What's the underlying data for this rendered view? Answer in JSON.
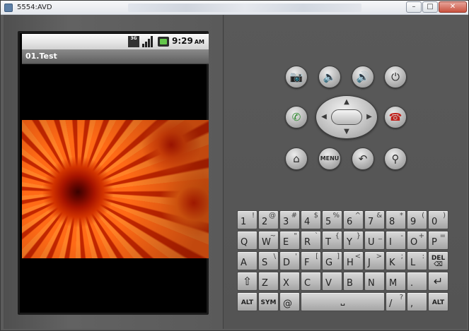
{
  "window": {
    "title": "5554:AVD",
    "minimize_icon": "minimize-icon",
    "maximize_icon": "maximize-icon",
    "close_icon": "close-icon"
  },
  "device": {
    "status_bar": {
      "network": "3G",
      "time": "9:29",
      "ampm": "AM",
      "icons": [
        "3g-icon",
        "signal-bars-icon",
        "battery-icon"
      ]
    },
    "app_title": "01.Test",
    "image": "flower-image"
  },
  "controls": {
    "camera_icon": "camera-icon",
    "volume_down_icon": "volume-down-icon",
    "volume_up_icon": "volume-up-icon",
    "power_icon": "power-icon",
    "call_icon": "call-icon",
    "end_call_icon": "end-call-icon",
    "home_icon": "home-icon",
    "menu_label": "MENU",
    "back_icon": "back-icon",
    "search_icon": "search-icon"
  },
  "keyboard": {
    "rows": [
      [
        {
          "m": "1",
          "a": "!"
        },
        {
          "m": "2",
          "a": "@"
        },
        {
          "m": "3",
          "a": "#"
        },
        {
          "m": "4",
          "a": "$"
        },
        {
          "m": "5",
          "a": "%"
        },
        {
          "m": "6",
          "a": "^"
        },
        {
          "m": "7",
          "a": "&"
        },
        {
          "m": "8",
          "a": "*"
        },
        {
          "m": "9",
          "a": "("
        },
        {
          "m": "0",
          "a": ")"
        }
      ],
      [
        {
          "m": "Q",
          "a": ""
        },
        {
          "m": "W",
          "a": "~"
        },
        {
          "m": "E",
          "a": "\""
        },
        {
          "m": "R",
          "a": "`"
        },
        {
          "m": "T",
          "a": "{"
        },
        {
          "m": "Y",
          "a": "}"
        },
        {
          "m": "U",
          "a": "_"
        },
        {
          "m": "I",
          "a": "-"
        },
        {
          "m": "O",
          "a": "+"
        },
        {
          "m": "P",
          "a": "="
        }
      ],
      [
        {
          "m": "A",
          "a": ""
        },
        {
          "m": "S",
          "a": "\\"
        },
        {
          "m": "D",
          "a": "'"
        },
        {
          "m": "F",
          "a": "["
        },
        {
          "m": "G",
          "a": "]"
        },
        {
          "m": "H",
          "a": "<"
        },
        {
          "m": "J",
          "a": ">"
        },
        {
          "m": "K",
          "a": ";"
        },
        {
          "m": "L",
          "a": ":"
        },
        {
          "m": "DEL",
          "a": ""
        }
      ],
      [
        {
          "m": "⇧",
          "a": ""
        },
        {
          "m": "Z",
          "a": ""
        },
        {
          "m": "X",
          "a": ""
        },
        {
          "m": "C",
          "a": ""
        },
        {
          "m": "V",
          "a": ""
        },
        {
          "m": "B",
          "a": ""
        },
        {
          "m": "N",
          "a": ""
        },
        {
          "m": "M",
          "a": ""
        },
        {
          "m": ".",
          "a": ""
        },
        {
          "m": "↵",
          "a": ""
        }
      ]
    ],
    "bottom": {
      "alt_left": "ALT",
      "sym": "SYM",
      "at": "@",
      "space": "␣",
      "slash": "/",
      "slash_alt": "?",
      "comma": ",",
      "alt_right": "ALT"
    }
  }
}
